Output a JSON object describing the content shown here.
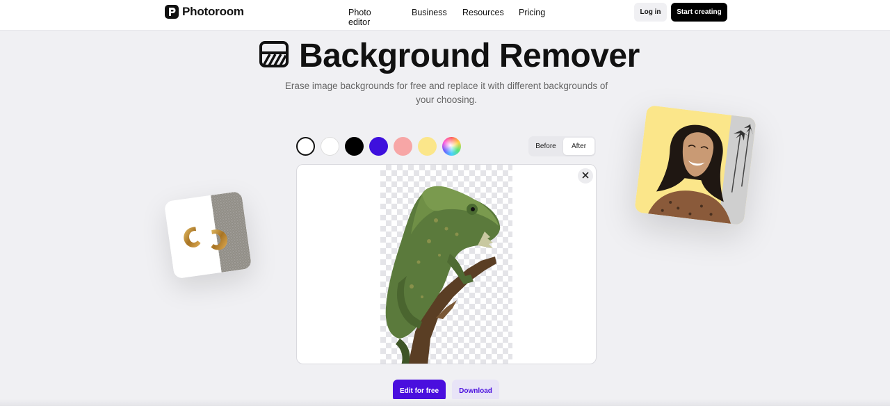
{
  "header": {
    "brand": "Photoroom",
    "nav": [
      "Photo editor",
      "Business",
      "Resources",
      "Pricing"
    ],
    "login_label": "Log in",
    "start_label": "Start creating"
  },
  "hero": {
    "title": "Background Remover",
    "subtitle": "Erase image backgrounds for free and replace it with different backgrounds of your choosing.",
    "icon": "background-remover-icon"
  },
  "editor": {
    "swatches": [
      {
        "name": "transparent",
        "color": "#ffffff",
        "selected": true
      },
      {
        "name": "white",
        "color": "#ffffff",
        "selected": false
      },
      {
        "name": "black",
        "color": "#000000",
        "selected": false
      },
      {
        "name": "purple",
        "color": "#3e10dd",
        "selected": false
      },
      {
        "name": "pink",
        "color": "#f7a6a6",
        "selected": false
      },
      {
        "name": "yellow",
        "color": "#fbe68a",
        "selected": false
      },
      {
        "name": "rainbow",
        "color": "gradient",
        "selected": false
      }
    ],
    "toggle": {
      "before": "Before",
      "after": "After",
      "active": "After"
    },
    "close_icon": "close-icon"
  },
  "actions": {
    "edit_label": "Edit for free",
    "download_label": "Download"
  },
  "colors": {
    "accent": "#4a0fde",
    "accent_light": "#e8e4f7",
    "page_bg": "#f0f0f3"
  }
}
